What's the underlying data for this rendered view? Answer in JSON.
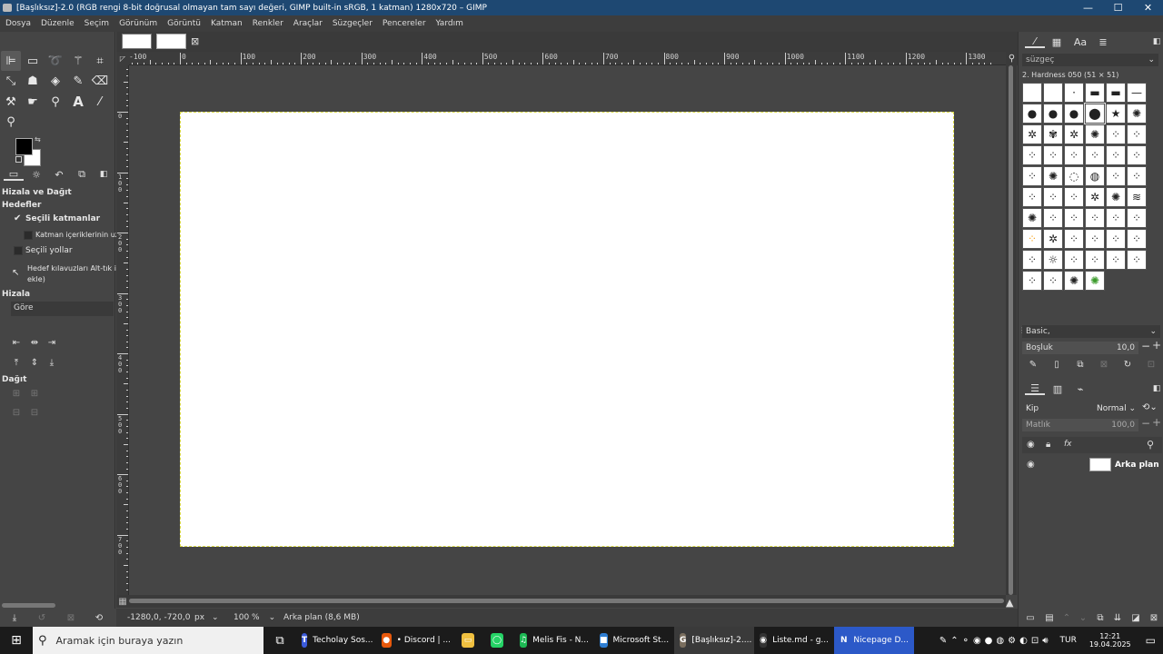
{
  "window": {
    "title": "[Başlıksız]-2.0 (RGB rengi 8-bit doğrusal olmayan tam sayı değeri, GIMP built-in sRGB, 1 katman) 1280x720 – GIMP",
    "minimize": "—",
    "maximize": "☐",
    "close": "✕"
  },
  "menu": [
    "Dosya",
    "Düzenle",
    "Seçim",
    "Görünüm",
    "Görüntü",
    "Katman",
    "Renkler",
    "Araçlar",
    "Süzgeçler",
    "Pencereler",
    "Yardım"
  ],
  "align_panel": {
    "title": "Hizala ve Dağıt",
    "targets_label": "Hedefler",
    "selected_layers": "Seçili katmanlar",
    "layer_contents": "Katman içeriklerinin uz",
    "selected_paths": "Seçili yollar",
    "guides_hint_line1": "Hedef kılavuzları Alt-tık i",
    "guides_hint_line2": "ekle)",
    "align_label": "Hizala",
    "relative_to": "Göre",
    "distribute_label": "Dağıt"
  },
  "rulers": {
    "h": [
      "0",
      "100",
      "200",
      "300",
      "400",
      "500",
      "600",
      "700",
      "800",
      "900",
      "1000",
      "1100",
      "1200",
      "1300"
    ],
    "h_neg": "-100",
    "v": [
      "0",
      "100",
      "200",
      "300",
      "400",
      "500",
      "600",
      "700"
    ]
  },
  "status": {
    "coords": "-1280,0, -720,0",
    "unit": "px",
    "zoom": "100 %",
    "layer_info": "Arka plan (8,6 MB)"
  },
  "brushes": {
    "filter_placeholder": "süzgeç",
    "current": "2. Hardness 050 (51 × 51)",
    "preset": "Basic,",
    "spacing_label": "Boşluk",
    "spacing_value": "10,0"
  },
  "layers": {
    "mode_label": "Kip",
    "mode_value": "Normal",
    "opacity_label": "Matlık",
    "opacity_value": "100,0",
    "layer_name": "Arka plan"
  },
  "taskbar": {
    "search_placeholder": "Aramak için buraya yazın",
    "apps": [
      {
        "label": "Techolay Sos...",
        "color": "#3b5bdb",
        "glyph": "T"
      },
      {
        "label": "• Discord | ...",
        "color": "#e8590c",
        "glyph": "●"
      },
      {
        "label": "",
        "color": "#f0c040",
        "glyph": "▭"
      },
      {
        "label": "",
        "color": "#25d366",
        "glyph": "◯"
      },
      {
        "label": "Melis Fis - N...",
        "color": "#1db954",
        "glyph": "♫"
      },
      {
        "label": "Microsoft St...",
        "color": "#2d7dd2",
        "glyph": "■"
      },
      {
        "label": "[Başlıksız]-2....",
        "color": "#7a6e5e",
        "glyph": "G"
      },
      {
        "label": "Liste.md - g...",
        "color": "#333",
        "glyph": "◉"
      },
      {
        "label": "Nicepage D...",
        "color": "#2c59c8",
        "glyph": "N"
      }
    ],
    "lang": "TUR",
    "time": "12:21",
    "date": "19.04.2025"
  },
  "colors": {
    "titlebar": "#1e4872",
    "taskbar": "#1b1b1b",
    "panel": "#454545",
    "nicepage_highlight": "#2c59c8"
  }
}
